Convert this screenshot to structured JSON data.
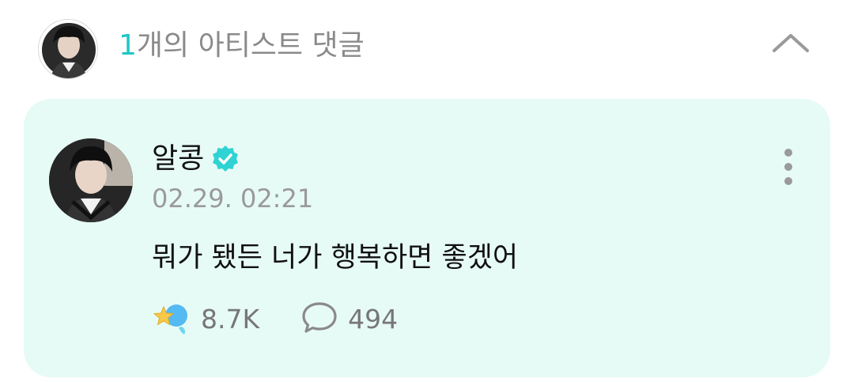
{
  "header": {
    "count": "1",
    "title_suffix": "개의 아티스트 댓글",
    "collapse_icon": "chevron-up-icon"
  },
  "comment": {
    "author": "알콩",
    "verified_icon": "verified-badge-icon",
    "timestamp": "02.29. 02:21",
    "text": "뭐가 됐든 너가 행복하면 좋겠어",
    "reaction_icon": "star-reaction-icon",
    "reaction_count": "8.7K",
    "reply_icon": "comment-bubble-icon",
    "reply_count": "494",
    "more_icon": "more-vertical-icon"
  },
  "colors": {
    "accent": "#20c6c6",
    "card_bg": "#e7fbf6",
    "muted_text": "#9a9a9a"
  }
}
